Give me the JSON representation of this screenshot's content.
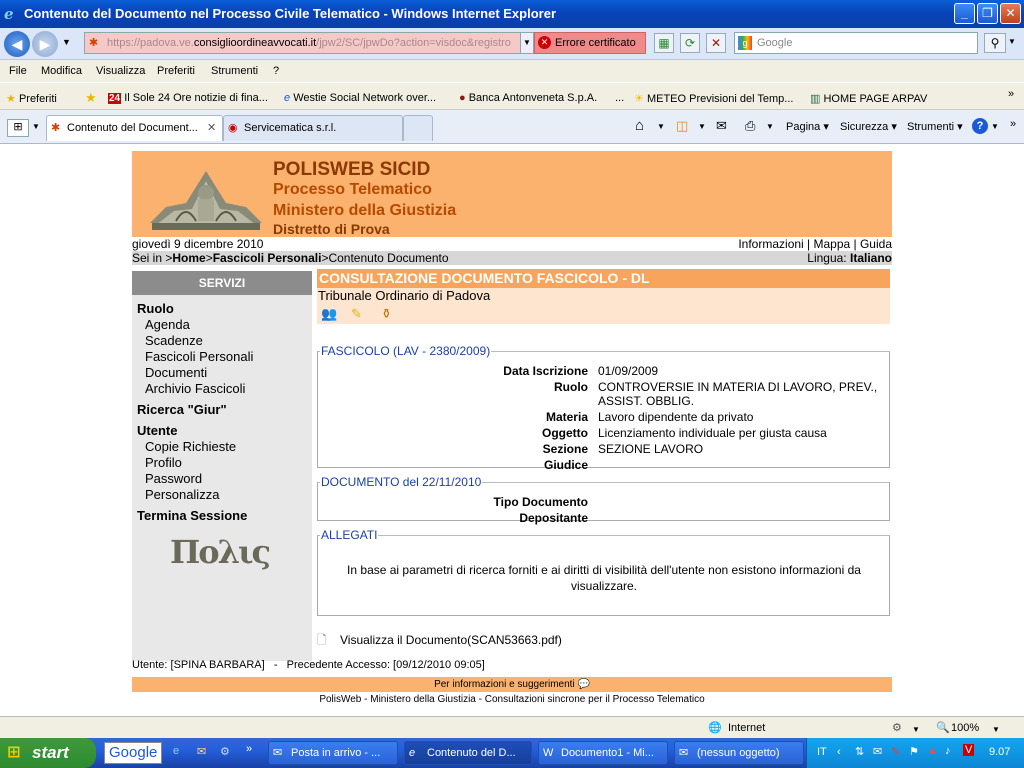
{
  "window": {
    "title": "Contenuto del Documento nel Processo Civile Telematico - Windows Internet Explorer"
  },
  "address": {
    "url_prefix": "https://padova.ve.",
    "url_host": "consiglioordineavvocati.it",
    "url_path": "/jpw2/SC/jpwDo?action=visdoc&registro",
    "cert_error": "Errore certificato",
    "search_placeholder": "Google"
  },
  "menu": [
    "File",
    "Modifica",
    "Visualizza",
    "Preferiti",
    "Strumenti",
    "?"
  ],
  "favorites": {
    "label": "Preferiti",
    "items": [
      "Il Sole 24 Ore notizie di fina...",
      "Westie Social Network over...",
      "Banca Antonveneta S.p.A.",
      "METEO  Previsioni del Temp...",
      "HOME PAGE ARPAV"
    ]
  },
  "tabs": [
    {
      "label": "Contenuto del Document..."
    },
    {
      "label": "Servicematica s.r.l."
    }
  ],
  "commandbar": {
    "page": "Pagina",
    "security": "Sicurezza",
    "tools": "Strumenti"
  },
  "page": {
    "banner": {
      "l1": "POLISWEB SICID",
      "l2": "Processo Telematico",
      "l3": "Ministero della Giustizia",
      "l4": "Distretto di Prova"
    },
    "date": "giovedì 9 dicembre 2010",
    "toplinks": "Informazioni | Mappa | Guida",
    "crumbs": {
      "prefix": "Sei in >",
      "home": "Home",
      "fascicoli": "Fascicoli Personali",
      "current": "Contenuto Documento",
      "lang_label": "Lingua:",
      "lang": "Italiano"
    },
    "sidebar": {
      "header": "SERVIZI",
      "ruolo": "Ruolo",
      "agenda": "Agenda",
      "scadenze": "Scadenze",
      "fascicoli": "Fascicoli Personali",
      "documenti": "Documenti",
      "archivio": "Archivio Fascicoli",
      "ricerca": "Ricerca \"Giur\"",
      "utente": "Utente",
      "copie": "Copie Richieste",
      "profilo": "Profilo",
      "password": "Password",
      "personalizza": "Personalizza",
      "termina": "Termina Sessione",
      "logo_text": "Πολις"
    },
    "consult_title": "CONSULTAZIONE DOCUMENTO FASCICOLO - DL",
    "tribunale": "Tribunale Ordinario di Padova",
    "fascicolo": {
      "legend": "FASCICOLO (LAV - 2380/2009)",
      "data_label": "Data Iscrizione",
      "data": "01/09/2009",
      "ruolo_label": "Ruolo",
      "ruolo": "CONTROVERSIE IN MATERIA DI LAVORO, PREV., ASSIST. OBBLIG.",
      "materia_label": "Materia",
      "materia": "Lavoro dipendente da privato",
      "oggetto_label": "Oggetto",
      "oggetto": "Licenziamento individuale per giusta causa",
      "sezione_label": "Sezione",
      "sezione": "SEZIONE LAVORO",
      "giudice_label": "Giudice"
    },
    "documento": {
      "legend": "DOCUMENTO del 22/11/2010",
      "tipo_label": "Tipo Documento",
      "depositante_label": "Depositante"
    },
    "allegati": {
      "legend": "ALLEGATI",
      "message": "In base ai parametri di ricerca forniti e ai diritti di visibilità dell'utente non esistono informazioni da visualizzare."
    },
    "view_doc": "Visualizza il Documento(SCAN53663.pdf)",
    "footer_user": "Utente: [SPINA BARBARA]   -   Precedente Accesso: [09/12/2010 09:05]",
    "info": "Per informazioni e suggerimenti",
    "bottom": "PolisWeb - Ministero della Giustizia - Consultazioni sincrone per il Processo Telematico"
  },
  "status": {
    "zone": "Internet",
    "zoom": "100%"
  },
  "taskbar": {
    "start": "start",
    "google": "Google",
    "tasks": [
      "Posta in arrivo - ...",
      "Contenuto del D...",
      "Documento1 - Mi...",
      "(nessun oggetto)"
    ],
    "lang": "IT",
    "clock": "9.07"
  }
}
